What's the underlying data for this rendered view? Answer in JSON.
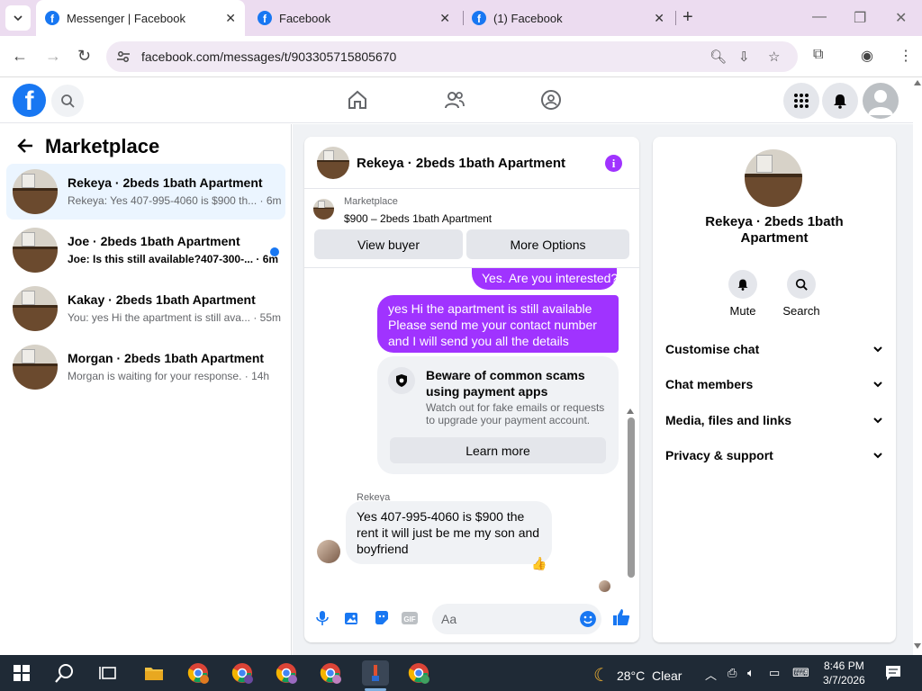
{
  "browser": {
    "tabs": [
      {
        "title": "Messenger | Facebook"
      },
      {
        "title": "Facebook"
      },
      {
        "title": "(1) Facebook"
      }
    ],
    "url": "facebook.com/messages/t/903305715805670"
  },
  "left": {
    "title": "Marketplace",
    "conversations": [
      {
        "name": "Rekeya · 2beds 1bath Apartment",
        "preview": "Rekeya: Yes 407-995-4060 is $900 th... · 6m",
        "unread": false,
        "selected": true
      },
      {
        "name": "Joe · 2beds 1bath Apartment",
        "preview": "Joe: Is this still available?407-300-... · 6m",
        "unread": true,
        "selected": false
      },
      {
        "name": "Kakay · 2beds 1bath Apartment",
        "preview": "You: yes Hi the apartment is still ava... · 55m",
        "unread": false,
        "selected": false
      },
      {
        "name": "Morgan · 2beds 1bath Apartment",
        "preview": "Morgan is waiting for your response. · 14h",
        "unread": false,
        "selected": false
      }
    ]
  },
  "chat": {
    "title": "Rekeya · 2beds 1bath Apartment",
    "listing_category": "Marketplace",
    "listing_price": "$900 – 2beds 1bath Apartment",
    "view_buyer": "View buyer",
    "more_options": "More Options",
    "msg_out_1": "Yes. Are you interested?",
    "msg_out_2": "yes Hi the apartment is still available Please send me your contact number and I will send you all the details",
    "scam_title": "Beware of common scams using payment apps",
    "scam_sub": "Watch out for fake emails or requests to upgrade your payment account.",
    "learn_more": "Learn more",
    "sender": "Rekeya",
    "msg_in": "Yes 407-995-4060 is $900 the rent it will just be me my son and boyfriend",
    "reaction": "👍",
    "composer_placeholder": "Aa",
    "accent": "#a033ff"
  },
  "details": {
    "name": "Rekeya · 2beds 1bath Apartment",
    "mute": "Mute",
    "search": "Search",
    "sections": [
      "Customise chat",
      "Chat members",
      "Media, files and links",
      "Privacy & support"
    ]
  },
  "taskbar": {
    "weather": "28°C  Clear",
    "time": "8:46 PM",
    "date": "3/7/2026"
  }
}
